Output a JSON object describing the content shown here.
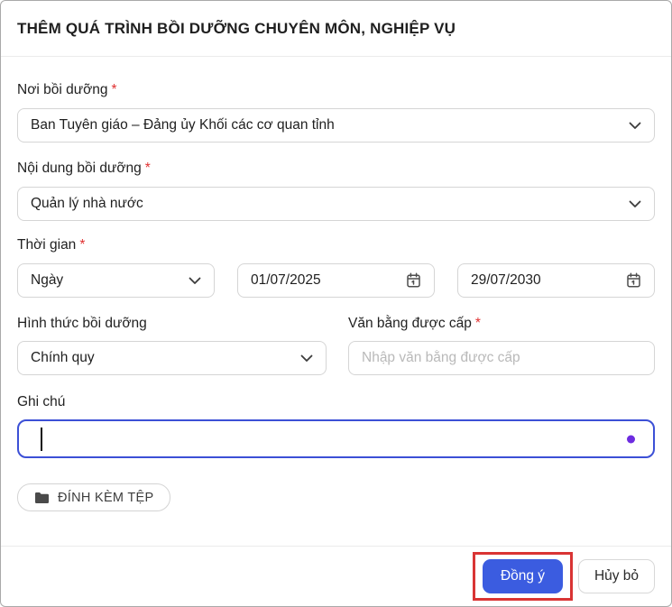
{
  "dialog": {
    "title": "THÊM QUÁ TRÌNH BỒI DƯỠNG CHUYÊN MÔN, NGHIỆP VỤ"
  },
  "fields": {
    "noi_boi_duong": {
      "label": "Nơi bồi dưỡng",
      "required": "*",
      "value": "Ban Tuyên giáo – Đảng ủy Khối các cơ quan tỉnh"
    },
    "noi_dung_boi_duong": {
      "label": "Nội dung bồi dưỡng",
      "required": "*",
      "value": "Quản lý nhà nước"
    },
    "thoi_gian": {
      "label": "Thời gian",
      "required": "*",
      "unit_value": "Ngày",
      "start_date": "01/07/2025",
      "end_date": "29/07/2030"
    },
    "hinh_thuc_boi_duong": {
      "label": "Hình thức bồi dưỡng",
      "value": "Chính quy"
    },
    "van_bang_duoc_cap": {
      "label": "Văn bằng được cấp",
      "required": "*",
      "value": "",
      "placeholder": "Nhập văn bằng được cấp"
    },
    "ghi_chu": {
      "label": "Ghi chú",
      "value": ""
    }
  },
  "buttons": {
    "attach": "ĐÍNH KÈM TỆP",
    "ok": "Đồng ý",
    "cancel": "Hủy bỏ"
  },
  "colors": {
    "primary_blue": "#3b5ce0",
    "annotation_red": "#d93434",
    "required_red": "#e03131",
    "focus_border_blue": "#3c50d6",
    "dot_purple": "#6d2ce0"
  }
}
